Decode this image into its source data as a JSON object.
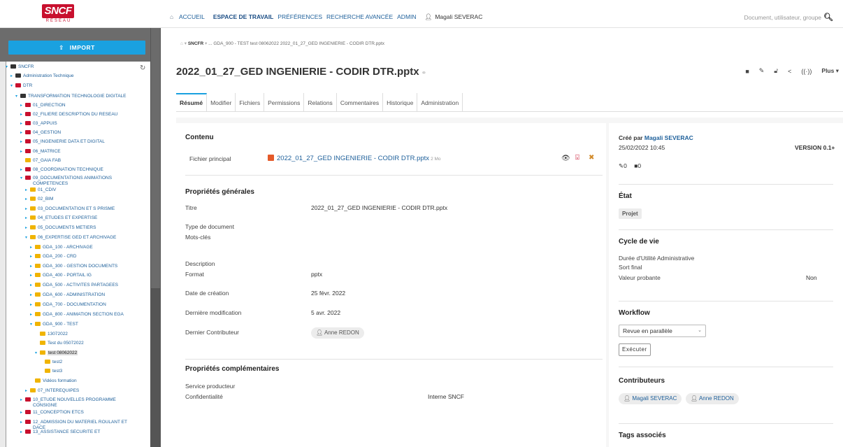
{
  "header": {
    "logo_text": "SNCF",
    "logo_sub": "RÉSEAU",
    "nav": [
      "ACCUEIL",
      "ESPACE DE TRAVAIL",
      "PRÉFÉRENCES",
      "RECHERCHE AVANCÉE",
      "ADMIN"
    ],
    "user": "Magali SEVERAC",
    "search_placeholder": "Document, utilisateur, groupe"
  },
  "sidebar": {
    "import_label": "IMPORT",
    "tree": [
      {
        "label": "SNCFR",
        "indent": 0,
        "icon": "dark",
        "twisty": "▾"
      },
      {
        "label": "Administration Technique",
        "indent": 1,
        "icon": "dark",
        "twisty": "▸"
      },
      {
        "label": "DTR",
        "indent": 1,
        "icon": "red",
        "twisty": "▾"
      },
      {
        "label": "TRANSFORMATION TECHNOLOGIE DIGITALE",
        "indent": 2,
        "icon": "dark",
        "twisty": "▾"
      },
      {
        "label": "01_DIRECTION",
        "indent": 3,
        "icon": "red",
        "twisty": "▸"
      },
      {
        "label": "02_FILIERE DESCRIPTION DU RESEAU",
        "indent": 3,
        "icon": "red",
        "twisty": "▸"
      },
      {
        "label": "03_APPUIS",
        "indent": 3,
        "icon": "red",
        "twisty": "▸"
      },
      {
        "label": "04_GESTION",
        "indent": 3,
        "icon": "red",
        "twisty": "▸"
      },
      {
        "label": "05_INGENIERIE DATA ET DIGITAL",
        "indent": 3,
        "icon": "red",
        "twisty": "▸"
      },
      {
        "label": "06_MATRICE",
        "indent": 3,
        "icon": "red",
        "twisty": "▸"
      },
      {
        "label": "07_GAIA FAB",
        "indent": 3,
        "icon": "yel",
        "twisty": ""
      },
      {
        "label": "08_COORDINATION TECHNIQUE",
        "indent": 3,
        "icon": "red",
        "twisty": "▸"
      },
      {
        "label": "09_DOCUMENTATIONS ANIMATIONS",
        "label2": "COMPETENCES",
        "indent": 3,
        "icon": "red",
        "twisty": "▾"
      },
      {
        "label": "01_CDIV",
        "indent": 4,
        "icon": "yel",
        "twisty": "▸"
      },
      {
        "label": "02_BIM",
        "indent": 4,
        "icon": "yel",
        "twisty": "▸"
      },
      {
        "label": "03_DOCUMENTATION ET S PRISME",
        "indent": 4,
        "icon": "yel",
        "twisty": "▸"
      },
      {
        "label": "04_ETUDES ET EXPERTISE",
        "indent": 4,
        "icon": "yel",
        "twisty": "▸"
      },
      {
        "label": "05_DOCUMENTS METIERS",
        "indent": 4,
        "icon": "yel",
        "twisty": "▸"
      },
      {
        "label": "06_EXPERTISE GED ET ARCHIVAGE",
        "indent": 4,
        "icon": "yel",
        "twisty": "▾"
      },
      {
        "label": "GDA_100 - ARCHIVAGE",
        "indent": 5,
        "icon": "yel",
        "twisty": "▸"
      },
      {
        "label": "GDA_200 - CRD",
        "indent": 5,
        "icon": "yel",
        "twisty": "▸"
      },
      {
        "label": "GDA_300 - GESTION DOCUMENTS",
        "indent": 5,
        "icon": "yel",
        "twisty": "▸"
      },
      {
        "label": "GDA_400 - PORTAIL IG",
        "indent": 5,
        "icon": "yel",
        "twisty": "▸"
      },
      {
        "label": "GDA_500 - ACTIVITES PARTAGEES",
        "indent": 5,
        "icon": "yel",
        "twisty": "▸"
      },
      {
        "label": "GDA_600 - ADMINISTRATION",
        "indent": 5,
        "icon": "yel",
        "twisty": "▸"
      },
      {
        "label": "GDA_700 - DOCUMENTATION",
        "indent": 5,
        "icon": "yel",
        "twisty": "▸"
      },
      {
        "label": "GDA_800 - ANIMATION SECTION EGA",
        "indent": 5,
        "icon": "yel",
        "twisty": "▸"
      },
      {
        "label": "GDA_900 - TEST",
        "indent": 5,
        "icon": "yel",
        "twisty": "▾"
      },
      {
        "label": "13072022",
        "indent": 6,
        "icon": "yel",
        "twisty": ""
      },
      {
        "label": "Test du 05072022",
        "indent": 6,
        "icon": "yel",
        "twisty": ""
      },
      {
        "label": "test 08062022",
        "indent": 6,
        "icon": "yel",
        "twisty": "▾",
        "selected": true
      },
      {
        "label": "test2",
        "indent": 7,
        "icon": "yel",
        "twisty": ""
      },
      {
        "label": "test3",
        "indent": 7,
        "icon": "yel",
        "twisty": ""
      },
      {
        "label": "Vidéos formation",
        "indent": 5,
        "icon": "yel",
        "twisty": ""
      },
      {
        "label": "07_INTEREQUIPES",
        "indent": 4,
        "icon": "yel",
        "twisty": "▸"
      },
      {
        "label": "10_ETUDE NOUVELLES PROGRAMME",
        "label2": "CONSIGNE",
        "indent": 3,
        "icon": "red",
        "twisty": "▸"
      },
      {
        "label": "11_CONCEPTION ETCS",
        "indent": 3,
        "icon": "red",
        "twisty": "▸"
      },
      {
        "label": "12_ADMISSION DU MATERIEL ROULANT ET",
        "label2": "DACE",
        "indent": 3,
        "icon": "red",
        "twisty": "▸"
      },
      {
        "label": "13_ASSISTANCE SECURITE ET",
        "indent": 3,
        "icon": "red",
        "twisty": "▸"
      }
    ]
  },
  "breadcrumb": {
    "root": "SNCFR",
    "rest": "...   GDA_900 - TEST   test 08062022   2022_01_27_GED INGENIERIE - CODIR DTR.pptx"
  },
  "document": {
    "title": "2022_01_27_GED INGENIERIE - CODIR DTR.pptx",
    "more_label": "Plus"
  },
  "tabs": [
    "Résumé",
    "Modifier",
    "Fichiers",
    "Permissions",
    "Relations",
    "Commentaires",
    "Historique",
    "Administration"
  ],
  "content": {
    "contenu_title": "Contenu",
    "fichier_label": "Fichier principal",
    "fichier_name": "2022_01_27_GED INGENIERIE - CODIR DTR.pptx",
    "fichier_size": "2 Mo",
    "generales_title": "Propriétés générales",
    "titre_label": "Titre",
    "titre_value": "2022_01_27_GED INGENIERIE - CODIR DTR.pptx",
    "type_label": "Type de document",
    "motscles_label": "Mots-clés",
    "description_label": "Description",
    "format_label": "Format",
    "format_value": "pptx",
    "creation_label": "Date de création",
    "creation_value": "25 févr. 2022",
    "modification_label": "Dernière modification",
    "modification_value": "5 avr. 2022",
    "contributeur_label": "Dernier Contributeur",
    "contributeur_value": "Anne REDON",
    "complementaires_title": "Propriétés complémentaires",
    "service_label": "Service producteur",
    "confidentialite_label": "Confidentialité",
    "confidentialite_value": "Interne SNCF"
  },
  "meta": {
    "cree_par_prefix": "Créé par",
    "cree_par_user": "Magali SEVERAC",
    "cree_date": "25/02/2022 10:45",
    "version": "VERSION 0.1+",
    "likes": "0",
    "comments": "0",
    "etat_title": "État",
    "etat_value": "Projet",
    "cycle_title": "Cycle de vie",
    "duree_label": "Durée d'Utilité Administrative",
    "sort_label": "Sort final",
    "valeur_label": "Valeur probante",
    "valeur_value": "Non",
    "workflow_title": "Workflow",
    "workflow_selected": "Revue en parallèle",
    "executer_label": "Exécuter",
    "contributeurs_title": "Contributeurs",
    "contributeurs": [
      "Magali SEVERAC",
      "Anne REDON"
    ],
    "tags_title": "Tags associés"
  }
}
